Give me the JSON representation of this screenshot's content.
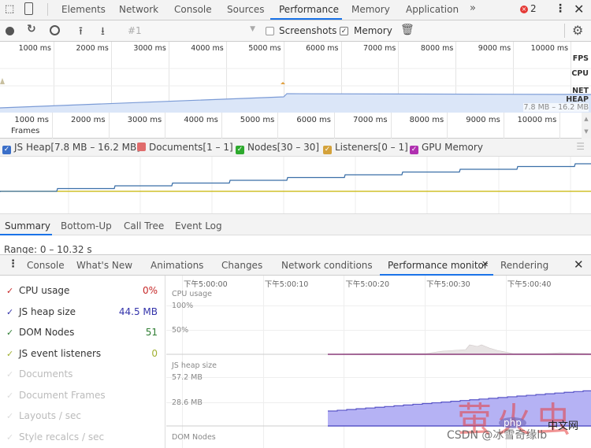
{
  "main_tabs": [
    "Elements",
    "Network",
    "Console",
    "Sources",
    "Performance",
    "Memory",
    "Application"
  ],
  "active_tab": "Performance",
  "more_tabs_icon": "»",
  "error_count": "2",
  "toolbar": {
    "profile_select": "#1",
    "screenshots_label": "Screenshots",
    "screenshots_checked": false,
    "memory_label": "Memory",
    "memory_checked": true
  },
  "overview": {
    "ticks": [
      "1000 ms",
      "2000 ms",
      "3000 ms",
      "4000 ms",
      "5000 ms",
      "6000 ms",
      "7000 ms",
      "8000 ms",
      "9000 ms",
      "10000 ms"
    ],
    "fps_label": "FPS",
    "cpu_label": "CPU",
    "net_label": "NET",
    "heap_label": "HEAP",
    "heap_range": "7.8 MB – 16.2 MB"
  },
  "timeline": {
    "ticks": [
      "1000 ms",
      "2000 ms",
      "3000 ms",
      "4000 ms",
      "5000 ms",
      "6000 ms",
      "7000 ms",
      "8000 ms",
      "9000 ms",
      "10000 ms"
    ],
    "frames_label": "Frames"
  },
  "counters": [
    {
      "label": "JS Heap[7.8 MB – 16.2 MB]",
      "color": "#3b6fc8",
      "checked": true
    },
    {
      "label": "Documents[1 – 1]",
      "color": "#e06c6c",
      "checked": false
    },
    {
      "label": "Nodes[30 – 30]",
      "color": "#2eaa2e",
      "checked": true
    },
    {
      "label": "Listeners[0 – 1]",
      "color": "#d4a23b",
      "checked": true
    },
    {
      "label": "GPU Memory",
      "color": "#b030b0",
      "checked": true
    }
  ],
  "bottom_tabs": [
    "Summary",
    "Bottom-Up",
    "Call Tree",
    "Event Log"
  ],
  "range_text": "Range: 0 – 10.32 s",
  "drawer_tabs": [
    "Console",
    "What's New",
    "Animations",
    "Changes",
    "Network conditions",
    "Performance monitor",
    "Rendering"
  ],
  "drawer_active": "Performance monitor",
  "perf_monitor": {
    "metrics": [
      {
        "label": "CPU usage",
        "value": "0%",
        "color": "#c62828",
        "enabled": true
      },
      {
        "label": "JS heap size",
        "value": "44.5 MB",
        "color": "#3333aa",
        "enabled": true
      },
      {
        "label": "DOM Nodes",
        "value": "51",
        "color": "#2e7d32",
        "enabled": true
      },
      {
        "label": "JS event listeners",
        "value": "0",
        "color": "#a0b030",
        "enabled": true
      },
      {
        "label": "Documents",
        "value": "",
        "color": "#ccc",
        "enabled": false
      },
      {
        "label": "Document Frames",
        "value": "",
        "color": "#ccc",
        "enabled": false
      },
      {
        "label": "Layouts / sec",
        "value": "",
        "color": "#ccc",
        "enabled": false
      },
      {
        "label": "Style recalcs / sec",
        "value": "",
        "color": "#ccc",
        "enabled": false
      }
    ],
    "time_ticks": [
      "下午5:00:00",
      "下午5:00:10",
      "下午5:00:20",
      "下午5:00:30",
      "下午5:00:40"
    ],
    "cpu_title": "CPU usage",
    "cpu_100": "100%",
    "cpu_50": "50%",
    "heap_title": "JS heap size",
    "heap_max": "57.2 MB",
    "heap_mid": "28.6 MB",
    "dom_title": "DOM Nodes"
  },
  "watermark": {
    "csdn": "CSDN @冰雪奇缘lb",
    "php": "php",
    "cn": "中文网"
  }
}
